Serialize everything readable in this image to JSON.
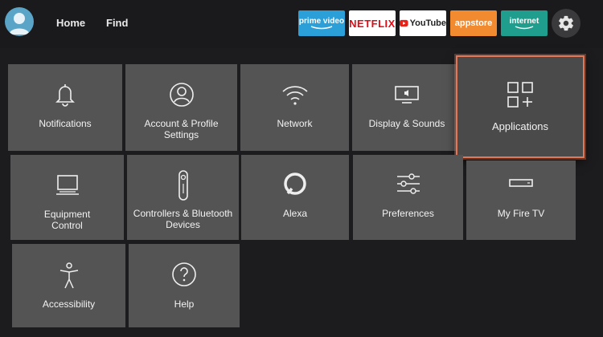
{
  "nav": {
    "home": "Home",
    "find": "Find"
  },
  "apps": [
    {
      "label": "prime video",
      "bg": "#2a9fd8",
      "fg": "#ffffff",
      "icon": "prime-video-logo"
    },
    {
      "label": "NETFLIX",
      "bg": "#ffffff",
      "fg": "#e50914",
      "icon": "netflix-logo"
    },
    {
      "label": "YouTube",
      "bg": "#ffffff",
      "fg": "#222222",
      "icon": "youtube-logo"
    },
    {
      "label": "appstore",
      "bg": "#f28b30",
      "fg": "#ffffff",
      "icon": "appstore-logo"
    },
    {
      "label": "internet",
      "bg": "#1f9e8e",
      "fg": "#ffffff",
      "icon": "internet-logo"
    }
  ],
  "settings": {
    "notifications": "Notifications",
    "account_line1": "Account & Profile",
    "account_line2": "Settings",
    "network": "Network",
    "display": "Display & Sounds",
    "applications": "Applications",
    "equipment_line1": "Equipment",
    "equipment_line2": "Control",
    "controllers_line1": "Controllers & Bluetooth",
    "controllers_line2": "Devices",
    "alexa": "Alexa",
    "preferences": "Preferences",
    "my_fire_tv": "My Fire TV",
    "accessibility": "Accessibility",
    "help": "Help"
  },
  "colors": {
    "focus_border": "#e0795a",
    "tile_bg": "#545454",
    "background": "#1c1c1e"
  }
}
